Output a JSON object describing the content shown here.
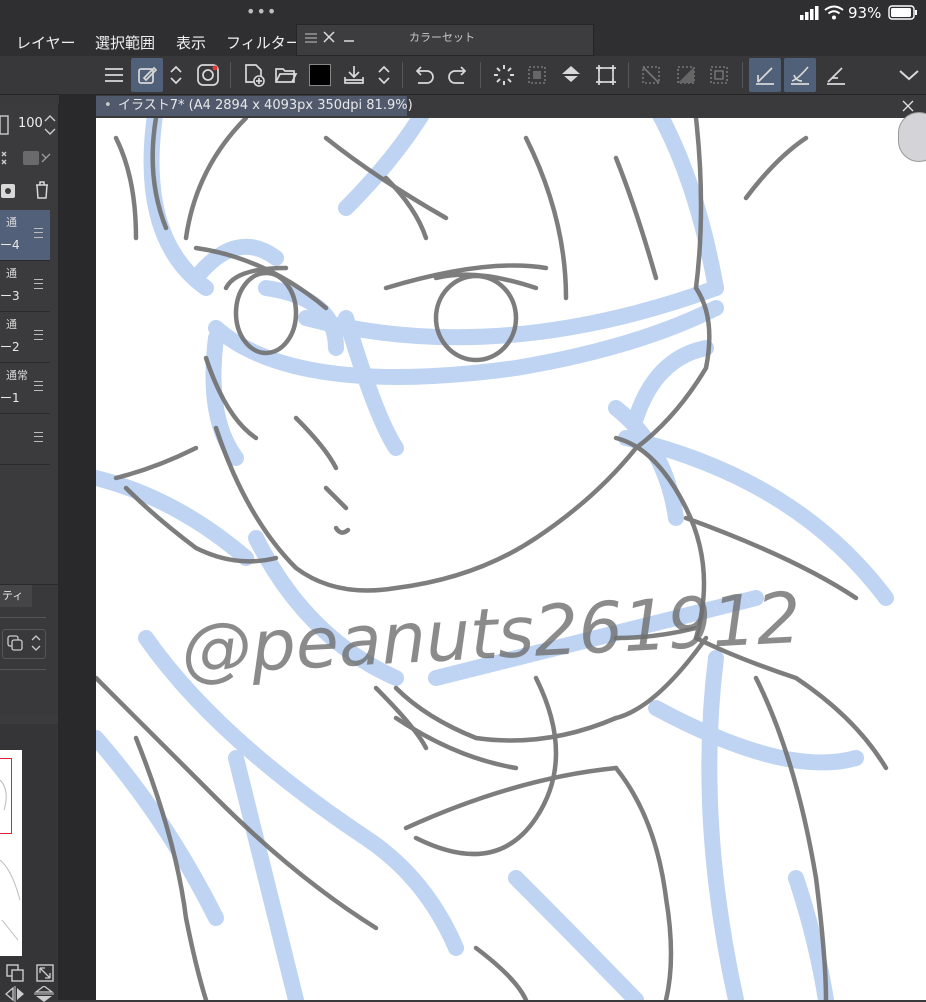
{
  "status": {
    "dots": "•••",
    "battery": "93%"
  },
  "menu": [
    "レイヤー",
    "選択範囲",
    "表示",
    "フィルター"
  ],
  "color_set": {
    "title": "カラーセット"
  },
  "canvas_tab": {
    "label": "イラスト7* (A4 2894 x 4093px 350dpi 81.9%)"
  },
  "layer_panel": {
    "opacity": "100",
    "layers": [
      {
        "mode": "通",
        "name": "ー4",
        "selected": true
      },
      {
        "mode": "通",
        "name": "ー3",
        "selected": false
      },
      {
        "mode": "通",
        "name": "ー2",
        "selected": false
      },
      {
        "mode": "通常",
        "name": "ー1",
        "selected": false
      },
      {
        "mode": "",
        "name": "",
        "selected": false
      }
    ],
    "property_tab": "ティ"
  },
  "watermark": "@peanuts261912",
  "colors": {
    "accent": "#4f6078",
    "sketch_blue": "#a9c6ee",
    "sketch_gray": "#6f6f6f"
  }
}
